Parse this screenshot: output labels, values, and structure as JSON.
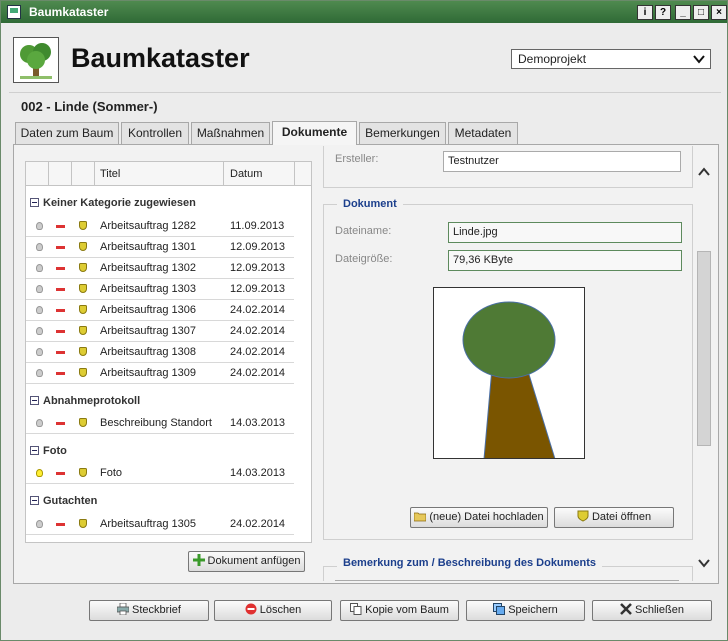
{
  "window": {
    "title": "Baumkataster",
    "buttons": [
      "i",
      "?",
      "_",
      "□",
      "×"
    ]
  },
  "header": {
    "app_title": "Baumkataster",
    "project": "Demoprojekt"
  },
  "record": {
    "heading": "002 - Linde (Sommer-)"
  },
  "tabs": [
    {
      "label": "Daten zum Baum",
      "active": false
    },
    {
      "label": "Kontrollen",
      "active": false
    },
    {
      "label": "Maßnahmen",
      "active": false
    },
    {
      "label": "Dokumente",
      "active": true
    },
    {
      "label": "Bemerkungen",
      "active": false
    },
    {
      "label": "Metadaten",
      "active": false
    }
  ],
  "doclist": {
    "columns": {
      "title": "Titel",
      "date": "Datum"
    },
    "categories": [
      {
        "name": "Keiner Kategorie zugewiesen",
        "rows": [
          {
            "title": "Arbeitsauftrag 1282",
            "date": "11.09.2013"
          },
          {
            "title": "Arbeitsauftrag 1301",
            "date": "12.09.2013"
          },
          {
            "title": "Arbeitsauftrag 1302",
            "date": "12.09.2013"
          },
          {
            "title": "Arbeitsauftrag 1303",
            "date": "12.09.2013"
          },
          {
            "title": "Arbeitsauftrag 1306",
            "date": "24.02.2014"
          },
          {
            "title": "Arbeitsauftrag 1307",
            "date": "24.02.2014"
          },
          {
            "title": "Arbeitsauftrag 1308",
            "date": "24.02.2014"
          },
          {
            "title": "Arbeitsauftrag 1309",
            "date": "24.02.2014"
          }
        ]
      },
      {
        "name": "Abnahmeprotokoll",
        "rows": [
          {
            "title": "Beschreibung Standort",
            "date": "14.03.2013"
          }
        ]
      },
      {
        "name": "Foto",
        "rows": [
          {
            "title": "Foto",
            "date": "14.03.2013",
            "highlight": true
          }
        ]
      },
      {
        "name": "Gutachten",
        "rows": [
          {
            "title": "Arbeitsauftrag 1305",
            "date": "24.02.2014"
          }
        ]
      }
    ],
    "add_button": "Dokument anfügen"
  },
  "details": {
    "creator_label": "Ersteller:",
    "creator_value": "Testnutzer",
    "document_legend": "Dokument",
    "filename_label": "Dateiname:",
    "filename_value": "Linde.jpg",
    "filesize_label": "Dateigröße:",
    "filesize_value": "79,36 KByte",
    "upload_button": "(neue) Datei hochladen",
    "open_button": "Datei öffnen",
    "remark_legend": "Bemerkung zum / Beschreibung des Dokuments"
  },
  "footer": {
    "steckbrief": "Steckbrief",
    "delete": "Löschen",
    "copy": "Kopie vom Baum",
    "save": "Speichern",
    "close": "Schließen"
  },
  "colors": {
    "titlebar": "#2f6a36",
    "legend": "#1c3f8c",
    "tree_crown": "#4f7a35",
    "tree_trunk": "#7a5500"
  }
}
